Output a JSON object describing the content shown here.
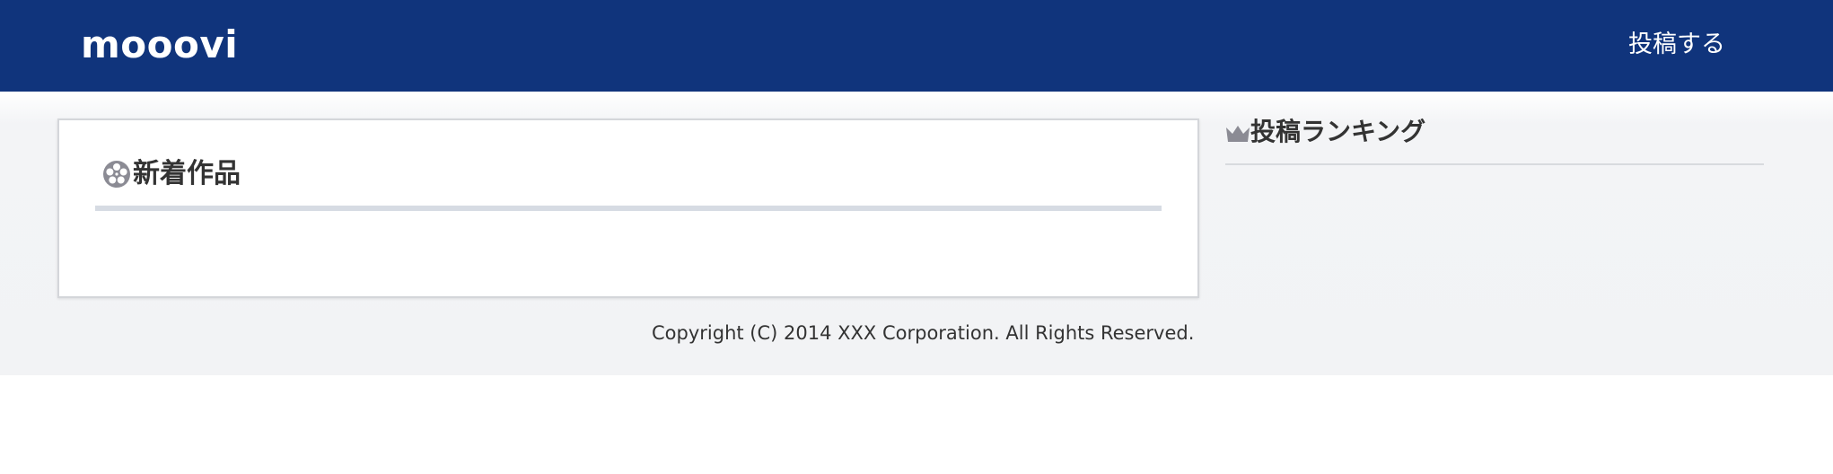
{
  "navbar": {
    "brand": "mooovi",
    "post_link": "投稿する",
    "background_color": "#10347c"
  },
  "main": {
    "new_works": {
      "icon": "film-reel-icon",
      "title": "新着作品"
    }
  },
  "sidebar": {
    "ranking": {
      "icon": "crown-icon",
      "title": "投稿ランキング"
    }
  },
  "footer": {
    "copyright": "Copyright (C) 2014 XXX Corporation. All Rights Reserved."
  }
}
